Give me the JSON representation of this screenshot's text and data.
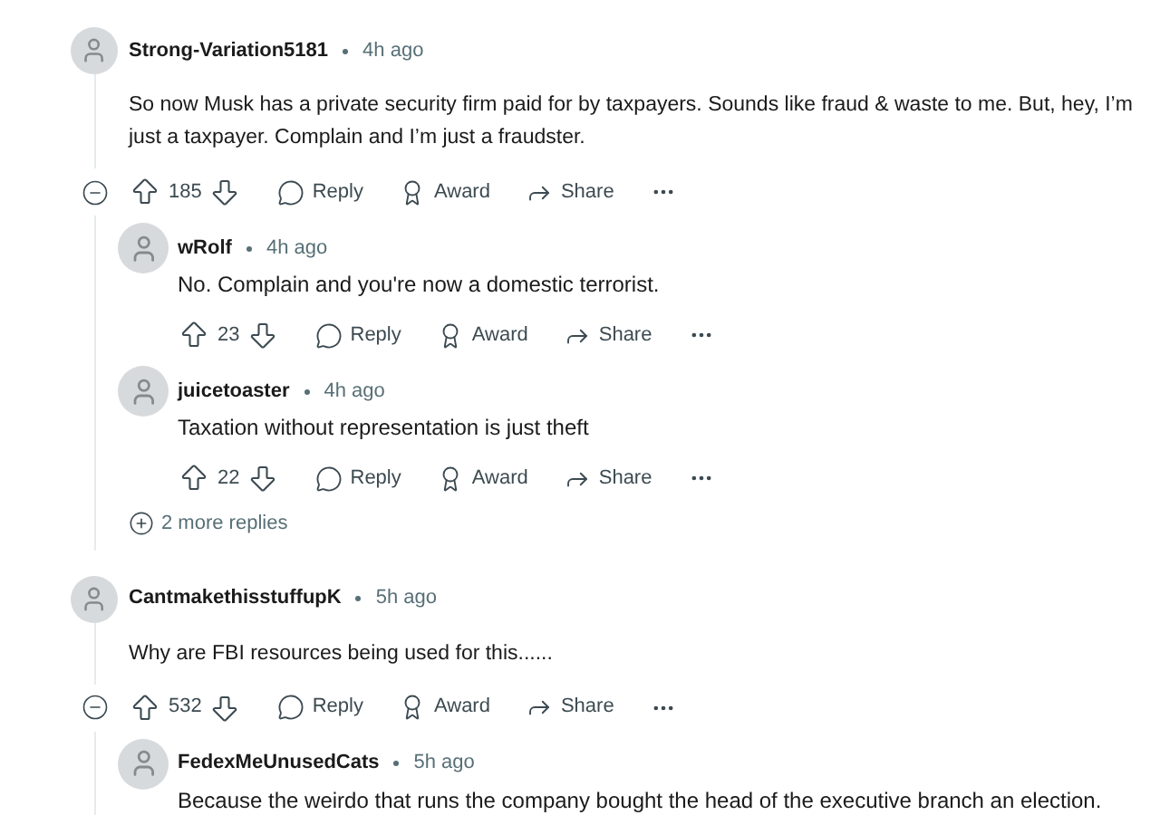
{
  "comments": [
    {
      "author": "Strong-Variation5181",
      "time": "4h ago",
      "body": "So now Musk has a private security firm paid for by taxpayers. Sounds like fraud & waste to me. But, hey, I’m just a taxpayer. Complain and I’m just a fraudster.",
      "score": "185",
      "actions": [
        "Reply",
        "Award",
        "Share"
      ],
      "expanded": true,
      "more_replies": "2 more replies",
      "children": [
        {
          "author": "wRolf",
          "time": "4h ago",
          "body": "No. Complain and you're now a domestic terrorist.",
          "score": "23",
          "actions": [
            "Reply",
            "Award",
            "Share"
          ]
        },
        {
          "author": "juicetoaster",
          "time": "4h ago",
          "body": "Taxation without representation is just theft",
          "score": "22",
          "actions": [
            "Reply",
            "Award",
            "Share"
          ]
        }
      ]
    },
    {
      "author": "CantmakethisstuffupK",
      "time": "5h ago",
      "body": "Why are FBI resources being used for this......",
      "score": "532",
      "actions": [
        "Reply",
        "Award",
        "Share"
      ],
      "expanded": true,
      "children": [
        {
          "author": "FedexMeUnusedCats",
          "time": "5h ago",
          "body": "Because the weirdo that runs the company bought the head of the executive branch an election."
        }
      ]
    }
  ]
}
